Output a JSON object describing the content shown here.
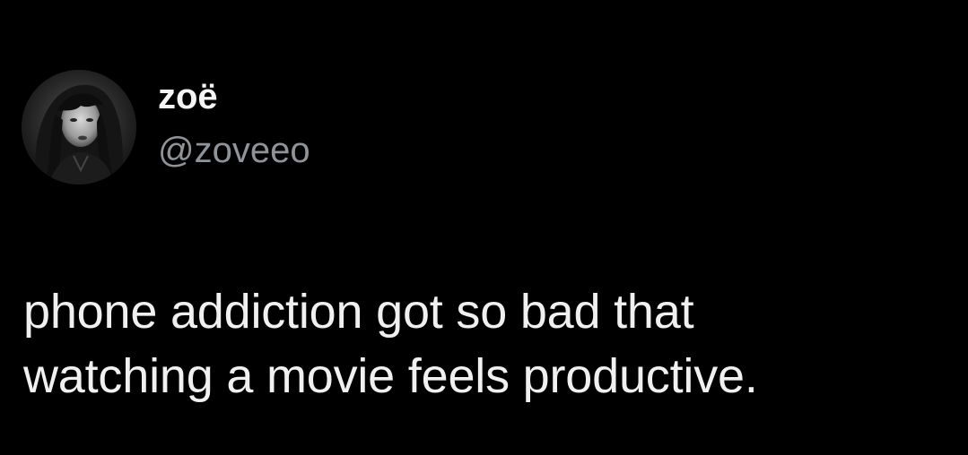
{
  "tweet": {
    "author": {
      "display_name": "zoë",
      "handle": "@zoveeo",
      "avatar_icon": "profile-photo-avatar"
    },
    "text_lines": [
      "phone addiction got so bad that",
      "watching a movie feels productive."
    ]
  },
  "colors": {
    "background": "#000000",
    "display_name": "#f4f4f4",
    "handle": "#8e9499",
    "text": "#f0f0f0"
  }
}
